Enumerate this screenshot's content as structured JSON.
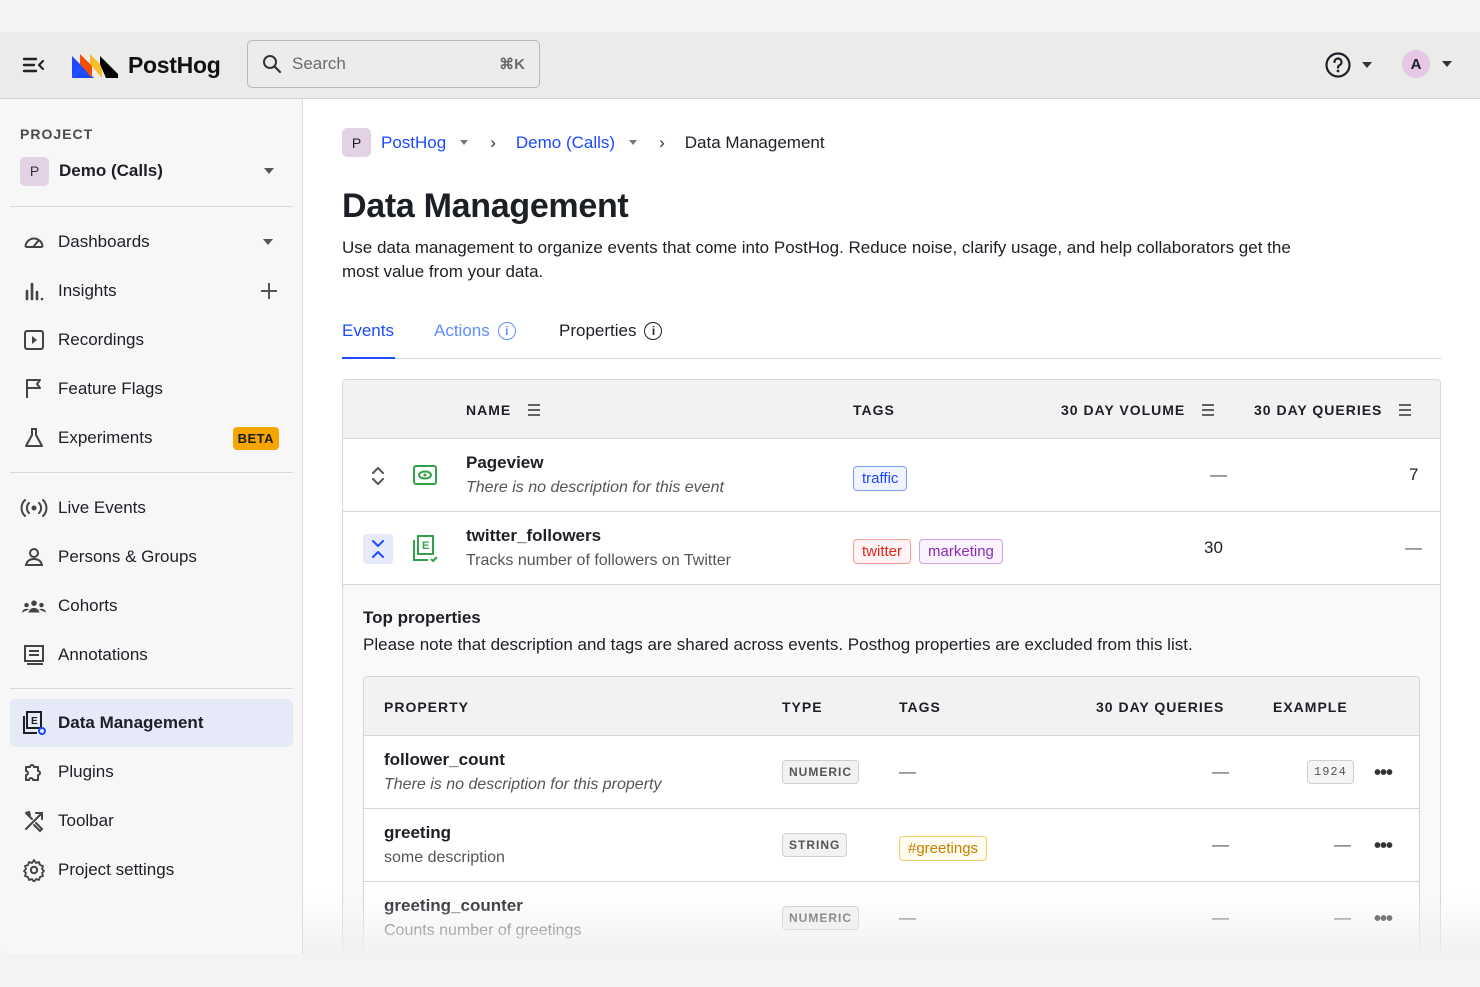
{
  "topbar": {
    "logo_text": "PostHog",
    "search_placeholder": "Search",
    "search_shortcut": "⌘K",
    "avatar_initial": "A"
  },
  "sidebar": {
    "project_label": "PROJECT",
    "project_badge": "P",
    "project_name": "Demo (Calls)",
    "items": [
      {
        "label": "Dashboards",
        "icon": "gauge-icon"
      },
      {
        "label": "Insights",
        "icon": "bar-chart-icon"
      },
      {
        "label": "Recordings",
        "icon": "play-square-icon"
      },
      {
        "label": "Feature Flags",
        "icon": "flag-icon"
      },
      {
        "label": "Experiments",
        "icon": "flask-icon",
        "badge": "BETA"
      },
      {
        "label": "Live Events",
        "icon": "broadcast-icon"
      },
      {
        "label": "Persons & Groups",
        "icon": "person-icon"
      },
      {
        "label": "Cohorts",
        "icon": "cohorts-icon"
      },
      {
        "label": "Annotations",
        "icon": "annotation-icon"
      },
      {
        "label": "Data Management",
        "icon": "data-management-icon",
        "active": true
      },
      {
        "label": "Plugins",
        "icon": "puzzle-icon"
      },
      {
        "label": "Toolbar",
        "icon": "tools-icon"
      },
      {
        "label": "Project settings",
        "icon": "gear-icon"
      }
    ]
  },
  "breadcrumbs": {
    "badge": "P",
    "org": "PostHog",
    "project": "Demo (Calls)",
    "sep": "›",
    "current": "Data Management"
  },
  "page": {
    "title": "Data Management",
    "description": "Use data management to organize events that come into PostHog. Reduce noise, clarify usage, and help collaborators get the most value from your data."
  },
  "tabs": [
    {
      "label": "Events",
      "active": true
    },
    {
      "label": "Actions"
    },
    {
      "label": "Properties"
    }
  ],
  "events_table": {
    "headers": {
      "name": "NAME",
      "tags": "TAGS",
      "volume": "30 DAY VOLUME",
      "queries": "30 DAY QUERIES"
    },
    "rows": [
      {
        "name": "Pageview",
        "description": "There is no description for this event",
        "tags": [
          "traffic"
        ],
        "volume": "—",
        "queries": "7"
      },
      {
        "name": "twitter_followers",
        "description": "Tracks number of followers on Twitter",
        "tags": [
          "twitter",
          "marketing"
        ],
        "volume": "30",
        "queries": "—"
      }
    ]
  },
  "top_properties": {
    "title": "Top properties",
    "note": "Please note that description and tags are shared across events. Posthog properties are excluded from this list.",
    "headers": {
      "property": "PROPERTY",
      "type": "TYPE",
      "tags": "TAGS",
      "queries": "30 DAY QUERIES",
      "example": "EXAMPLE"
    },
    "rows": [
      {
        "name": "follower_count",
        "description": "There is no description for this property",
        "type": "NUMERIC",
        "tags": "—",
        "queries": "—",
        "example": "1924"
      },
      {
        "name": "greeting",
        "description": "some description",
        "type": "STRING",
        "tag": "#greetings",
        "queries": "—",
        "example": "—"
      },
      {
        "name": "greeting_counter",
        "description": "Counts number of greetings",
        "type": "NUMERIC",
        "tags": "—",
        "queries": "—",
        "example": "—"
      }
    ]
  },
  "more_glyph": "•••",
  "colors": {
    "accent": "#1d4aff",
    "beta": "#f7a501",
    "active_bg": "#e5e9f8"
  }
}
